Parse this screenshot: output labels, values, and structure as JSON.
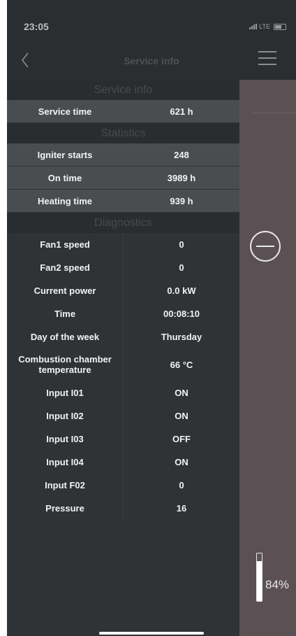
{
  "status_bar": {
    "time": "23:05",
    "network": "LTE"
  },
  "nav": {
    "title": "Service info"
  },
  "sections": {
    "service": {
      "header": "Service info",
      "rows": [
        {
          "label": "Service time",
          "value": "621 h"
        }
      ]
    },
    "statistics": {
      "header": "Statistics",
      "rows": [
        {
          "label": "Igniter starts",
          "value": "248"
        },
        {
          "label": "On time",
          "value": "3989 h"
        },
        {
          "label": "Heating time",
          "value": "939 h"
        }
      ]
    },
    "diagnostics": {
      "header": "Diagnostics",
      "rows": [
        {
          "label": "Fan1 speed",
          "value": "0"
        },
        {
          "label": "Fan2 speed",
          "value": "0"
        },
        {
          "label": "Current power",
          "value": "0.0 kW"
        },
        {
          "label": "Time",
          "value": "00:08:10"
        },
        {
          "label": "Day of the week",
          "value": "Thursday"
        },
        {
          "label": "Combustion chamber temperature",
          "value": "66 °C"
        },
        {
          "label": "Input I01",
          "value": "ON"
        },
        {
          "label": "Input I02",
          "value": "ON"
        },
        {
          "label": "Input I03",
          "value": "OFF"
        },
        {
          "label": "Input I04",
          "value": "ON"
        },
        {
          "label": "Input F02",
          "value": "0"
        },
        {
          "label": "Pressure",
          "value": "16"
        }
      ]
    }
  },
  "side_panel": {
    "level_percent": 84,
    "level_label": "84%"
  },
  "colors": {
    "panel_bg": "#2f3335",
    "side_bg": "#5b5155",
    "highlight_row": "#4a4d50"
  },
  "icons": {
    "back": "chevron-left-icon",
    "menu": "hamburger-menu-icon",
    "minus": "minus-circle-icon"
  }
}
